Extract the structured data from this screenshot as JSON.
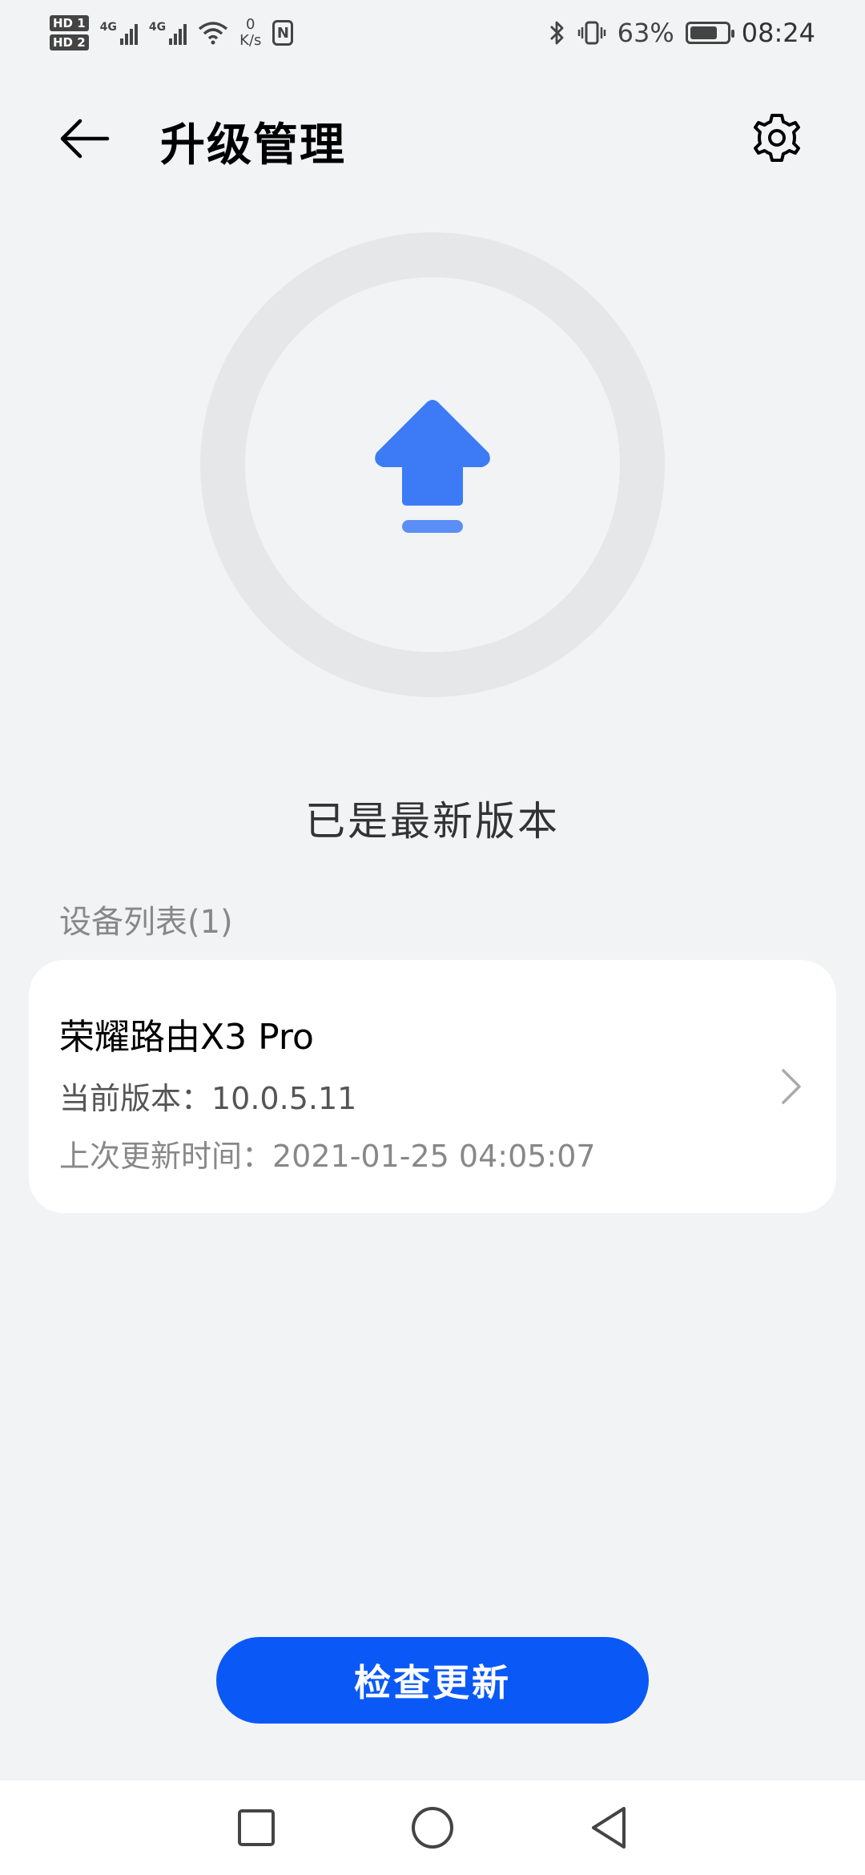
{
  "status_bar": {
    "hd1": "HD 1",
    "hd2": "HD 2",
    "network1": "4G",
    "network2": "4G",
    "speed_value": "0",
    "speed_unit": "K/s",
    "nfc": "N",
    "battery_percent": "63%",
    "time": "08:24"
  },
  "app_bar": {
    "title": "升级管理"
  },
  "upgrade": {
    "status_text": "已是最新版本",
    "accent_color": "#3D7BF6"
  },
  "devices": {
    "header": "设备列表(1)",
    "items": [
      {
        "name": "荣耀路由X3 Pro",
        "current_version": "当前版本：10.0.5.11",
        "last_update": "上次更新时间：2021-01-25 04:05:07"
      }
    ]
  },
  "actions": {
    "check_update_label": "检查更新",
    "button_color": "#0A59F7"
  },
  "icons": {
    "back": "arrow-left-icon",
    "settings": "gear-icon",
    "upgrade": "upload-arrow-icon",
    "chevron": "chevron-right-icon",
    "nav_recent": "square-icon",
    "nav_home": "circle-icon",
    "nav_back": "triangle-icon"
  }
}
